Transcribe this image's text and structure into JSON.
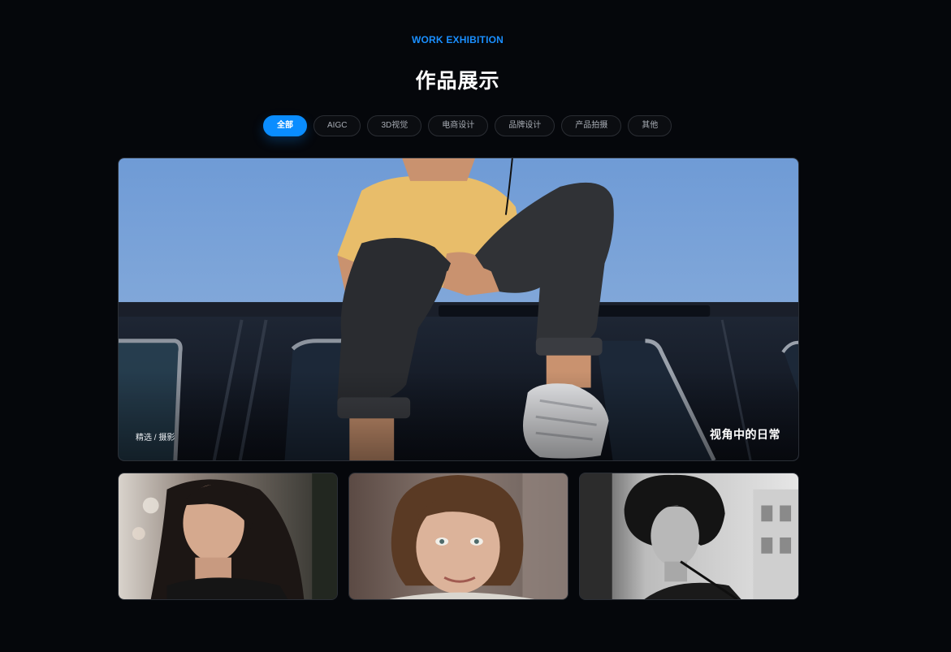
{
  "header": {
    "eyebrow": "WORK EXHIBITION",
    "title": "作品展示"
  },
  "tabs": [
    {
      "label": "全部",
      "active": true
    },
    {
      "label": "AIGC",
      "active": false
    },
    {
      "label": "3D视觉",
      "active": false
    },
    {
      "label": "电商设计",
      "active": false
    },
    {
      "label": "品牌设计",
      "active": false
    },
    {
      "label": "产品拍摄",
      "active": false
    },
    {
      "label": "其他",
      "active": false
    }
  ],
  "featured": {
    "tag": "精选 / 摄影",
    "caption": "视角中的日常"
  },
  "colors": {
    "accent": "#0a8dff",
    "background": "#05070b",
    "sky": "#7ea6d8"
  }
}
